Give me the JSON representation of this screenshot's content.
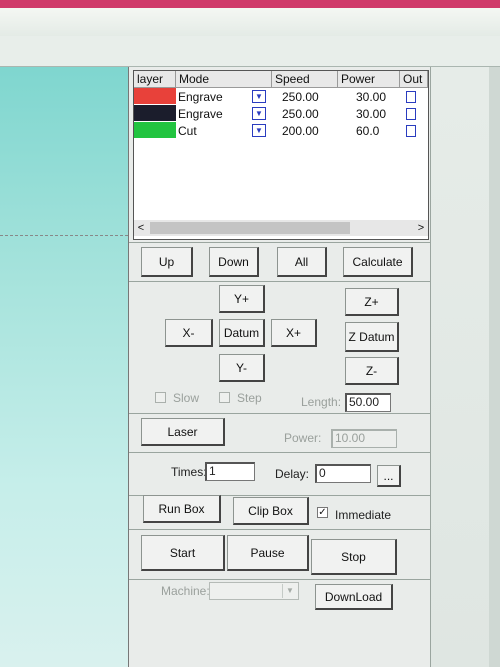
{
  "layers": {
    "headers": [
      "layer",
      "Mode",
      "Speed",
      "Power",
      "Out"
    ],
    "rows": [
      {
        "color": "#e8413a",
        "mode": "Engrave",
        "speed": "250.00",
        "power": "30.00"
      },
      {
        "color": "#1b1d2c",
        "mode": "Engrave",
        "speed": "250.00",
        "power": "30.00"
      },
      {
        "color": "#22c440",
        "mode": "Cut",
        "speed": "200.00",
        "power": "60.0"
      }
    ],
    "scroll_left": "<",
    "scroll_right": ">"
  },
  "order": {
    "up": "Up",
    "down": "Down",
    "all": "All",
    "calculate": "Calculate"
  },
  "move": {
    "y_plus": "Y+",
    "x_minus": "X-",
    "datum": "Datum",
    "x_plus": "X+",
    "y_minus": "Y-",
    "z_plus": "Z+",
    "z_datum": "Z Datum",
    "z_minus": "Z-",
    "slow": "Slow",
    "step": "Step",
    "length_label": "Length:",
    "length_value": "50.00"
  },
  "laser": {
    "button": "Laser",
    "power_label": "Power:",
    "power_value": "10.00"
  },
  "repeat": {
    "times_label": "Times:",
    "times_value": "1",
    "delay_label": "Delay:",
    "delay_value": "0",
    "more": "..."
  },
  "box": {
    "run_box": "Run Box",
    "clip_box": "Clip Box",
    "immediate": "Immediate",
    "immediate_check": "✓"
  },
  "control": {
    "start": "Start",
    "pause": "Pause",
    "stop": "Stop"
  },
  "machine": {
    "label": "Machine:",
    "download": "DownLoad"
  }
}
